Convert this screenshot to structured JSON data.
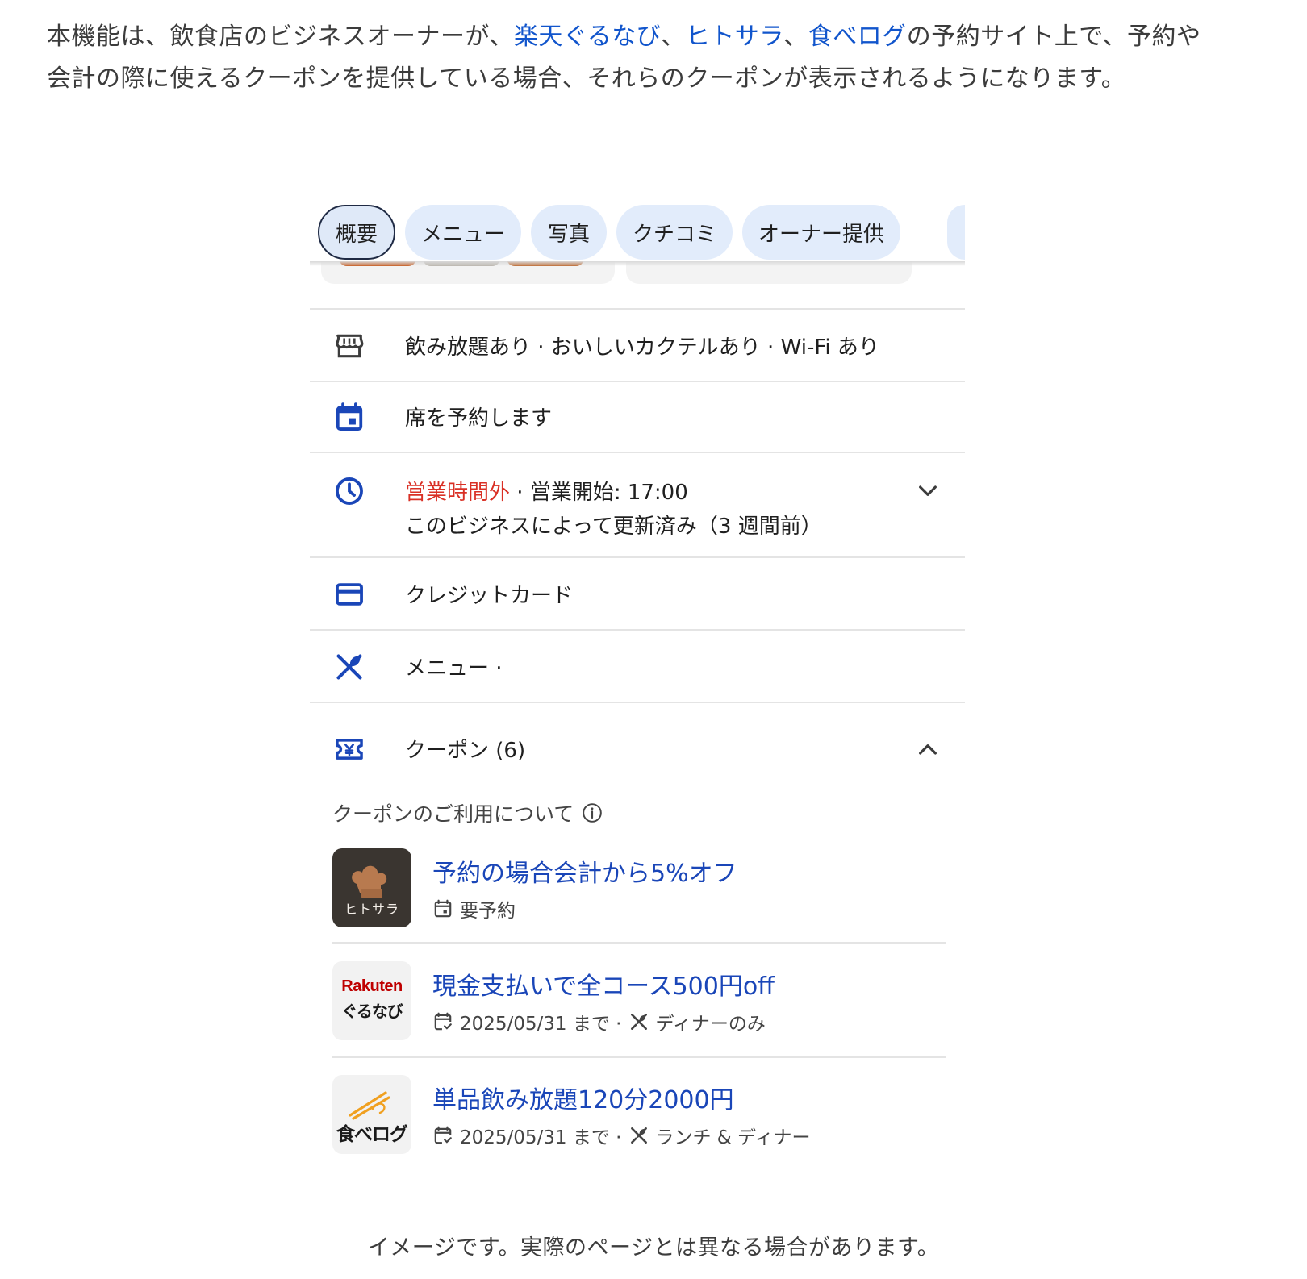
{
  "intro": {
    "part1": "本機能は、飲食店のビジネスオーナーが、",
    "link1": "楽天ぐるなび",
    "sep1": "、",
    "link2": "ヒトサラ",
    "sep2": "、",
    "link3": "食べログ",
    "part2": "の予約サイト上で、予約や会計の際に使えるクーポンを提供している場合、それらのクーポンが表示されるようになります。"
  },
  "chips": [
    {
      "label": "概要",
      "active": true
    },
    {
      "label": "メニュー"
    },
    {
      "label": "写真"
    },
    {
      "label": "クチコミ"
    },
    {
      "label": "オーナー提供"
    }
  ],
  "rows": {
    "amenities": {
      "icon": "storefront-icon",
      "text": "飲み放題あり · おいしいカクテルあり · Wi-Fi あり"
    },
    "reserve": {
      "icon": "calendar-icon",
      "text": "席を予約します"
    },
    "hours": {
      "icon": "clock-icon",
      "status": "営業時間外",
      "dot": " · ",
      "opens": "営業開始: 17:00",
      "sub": "このビジネスによって更新済み（3 週間前）"
    },
    "payment": {
      "icon": "credit-card-icon",
      "text": "クレジットカード"
    },
    "menu": {
      "icon": "utensils-icon",
      "text": "メニュー ·"
    },
    "coupons": {
      "icon": "coupon-icon",
      "text": "クーポン (6)"
    }
  },
  "coupon_note": "クーポンのご利用について",
  "coupons": [
    {
      "logo_text": "ヒトサラ",
      "title": "予約の場合会計から5%オフ",
      "meta": "要予約"
    },
    {
      "logo_text_top": "Rakuten",
      "logo_text_bottom": "ぐるなび",
      "title": "現金支払いで全コース500円off",
      "date": "2025/05/31 まで ·",
      "meal": "ディナーのみ"
    },
    {
      "logo_text": "食べログ",
      "title": "単品飲み放題120分2000円",
      "date": "2025/05/31 まで ·",
      "meal": "ランチ & ディナー"
    }
  ],
  "caption": "イメージです。実際のページとは異なる場合があります。",
  "colors": {
    "link": "#1155cc",
    "coupon_title": "#1a46b8",
    "icon_blue": "#1a46b8",
    "closed_red": "#d93025",
    "chip_bg": "#e2ecfb"
  }
}
